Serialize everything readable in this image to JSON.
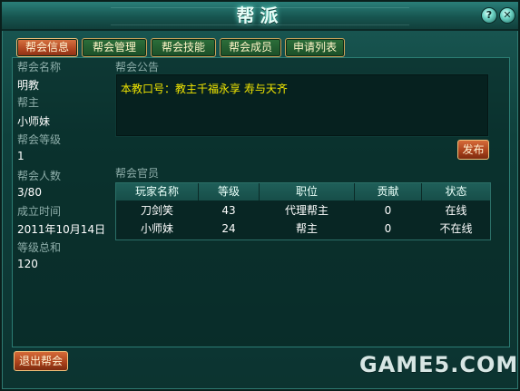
{
  "window": {
    "title": "帮派"
  },
  "titlebar": {
    "help_label": "?",
    "close_label": "✕"
  },
  "tabs": [
    {
      "label": "帮会信息",
      "active": true
    },
    {
      "label": "帮会管理",
      "active": false
    },
    {
      "label": "帮会技能",
      "active": false
    },
    {
      "label": "帮会成员",
      "active": false
    },
    {
      "label": "申请列表",
      "active": false
    }
  ],
  "info": {
    "name_label": "帮会名称",
    "name_value": "明教",
    "leader_label": "帮主",
    "leader_value": "小师妹",
    "level_label": "帮会等级",
    "level_value": "1",
    "members_label": "帮会人数",
    "members_value": "3/80",
    "created_label": "成立时间",
    "created_value": "2011年10月14日",
    "level_total_label": "等级总和",
    "level_total_value": "120"
  },
  "notice": {
    "label": "帮会公告",
    "text": "本教口号：教主千福永享 寿与天齐",
    "publish_label": "发布"
  },
  "officers": {
    "label": "帮会官员",
    "columns": [
      "玩家名称",
      "等级",
      "职位",
      "贡献",
      "状态"
    ],
    "rows": [
      {
        "name": "刀剑笑",
        "level": "43",
        "position": "代理帮主",
        "contribution": "0",
        "status": "在线"
      },
      {
        "name": "小师妹",
        "level": "24",
        "position": "帮主",
        "contribution": "0",
        "status": "不在线"
      }
    ]
  },
  "footer": {
    "leave_label": "退出帮会"
  },
  "watermark": "GAME5.COM",
  "colors": {
    "notice_text": "#f2e600",
    "label_text": "#8eaeaa",
    "tab_active": "#b04520",
    "tab_inactive": "#1b4f28"
  }
}
